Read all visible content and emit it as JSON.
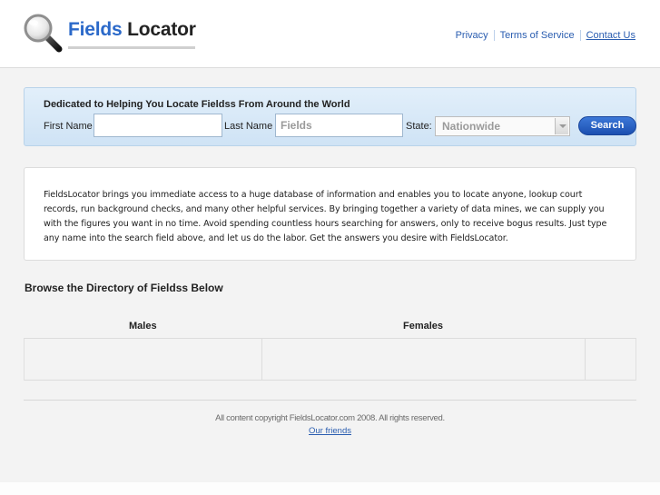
{
  "header": {
    "logo_accent": "Fields",
    "logo_rest": " Locator",
    "logo_icon": "magnifier-icon",
    "links": [
      "Privacy",
      "Terms of Service",
      "Contact Us"
    ]
  },
  "search": {
    "heading": "Dedicated to Helping You Locate Fieldss From Around the World",
    "first_name_label": "First Name",
    "first_name_value": "",
    "last_name_label": "Last Name",
    "last_name_placeholder": "Fields",
    "state_label": "State:",
    "state_selected": "Nationwide",
    "button_label": "Search"
  },
  "intro": {
    "text": "FieldsLocator brings you immediate access to a huge database of information and enables you to locate anyone, lookup court records, run background checks, and many other helpful services. By bringing together a variety of data mines, we can supply you with the figures you want in no time. Avoid spending countless hours searching for answers, only to receive bogus results. Just type any name into the search field above, and let us do the labor. Get the answers you desire with FieldsLocator."
  },
  "directory": {
    "title": "Browse the Directory of Fieldss Below",
    "columns": [
      "Males",
      "Females"
    ]
  },
  "footer": {
    "copyright": "All content copyright FieldsLocator.com 2008. All rights reserved.",
    "friends_link": "Our friends"
  },
  "colors": {
    "accent": "#2b69c9",
    "link": "#2a5db0",
    "button": "#1c4fb0",
    "panel": "#d6e8f8",
    "background": "#f3f3f3"
  }
}
